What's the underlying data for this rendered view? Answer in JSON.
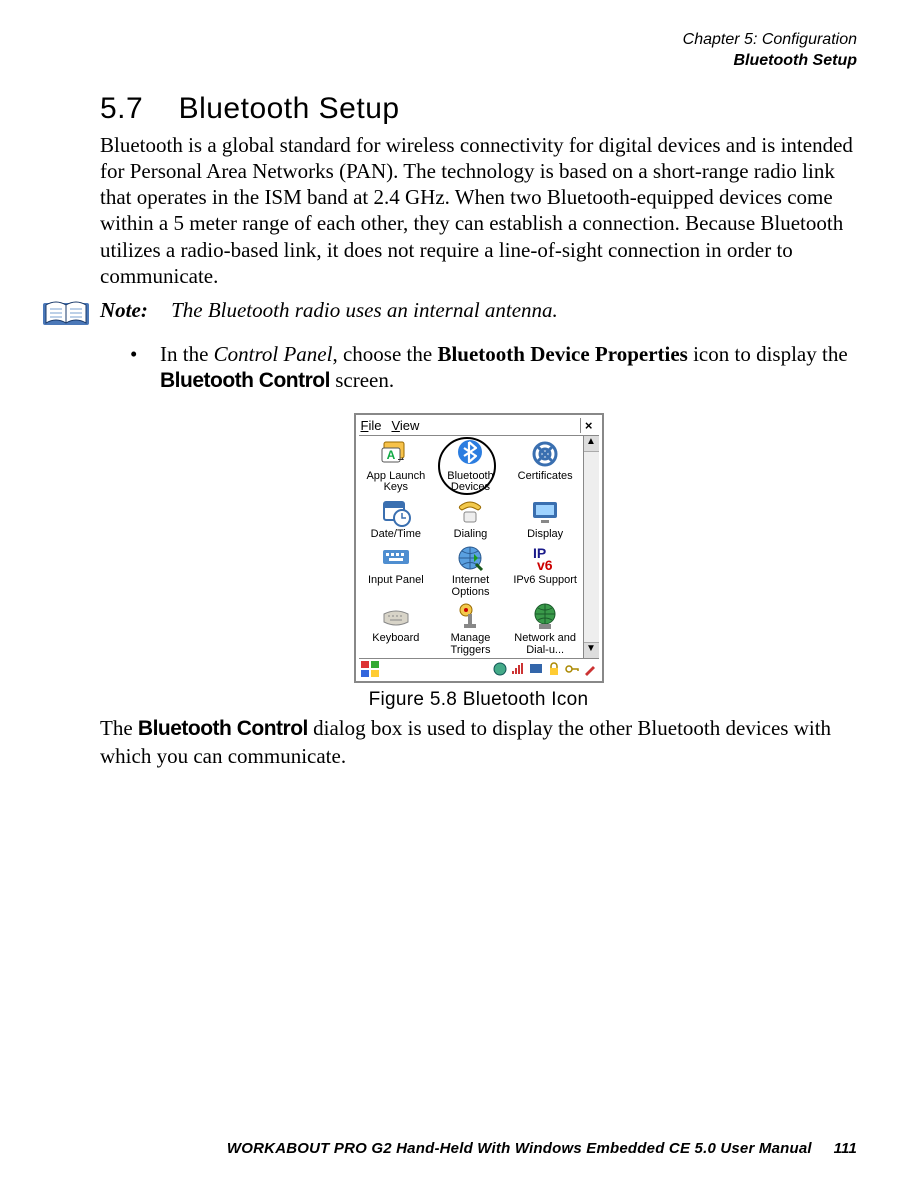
{
  "header": {
    "line1": "Chapter 5: Configuration",
    "line2": "Bluetooth Setup"
  },
  "section": {
    "number": "5.7",
    "title": "Bluetooth Setup"
  },
  "intro": "Bluetooth is a global standard for wireless connectivity for digital devices and is intended for Personal Area Networks (PAN). The technology is based on a short-range radio link that operates in the ISM band at 2.4 GHz. When two Bluetooth-equipped devices come within a 5 meter range of each other, they can establish a connection. Because Bluetooth utilizes a radio-based link, it does not require a line-of-sight connection in order to communicate.",
  "note": {
    "label": "Note:",
    "text": "The Bluetooth radio uses an internal antenna."
  },
  "bullet": {
    "pre": "In the ",
    "cp": "Control Panel",
    "mid1": ", choose the ",
    "bold": "Bluetooth Device Properties",
    "mid2": " icon to display the ",
    "sans": "Bluetooth Control",
    "end": " screen."
  },
  "panel": {
    "menu": {
      "file": "File",
      "view": "View",
      "close": "×"
    },
    "icons": [
      {
        "name": "app-launch-keys-icon",
        "label": "App Launch Keys"
      },
      {
        "name": "bluetooth-devices-icon",
        "label": "Bluetooth Devices"
      },
      {
        "name": "certificates-icon",
        "label": "Certificates"
      },
      {
        "name": "date-time-icon",
        "label": "Date/Time"
      },
      {
        "name": "dialing-icon",
        "label": "Dialing"
      },
      {
        "name": "display-icon",
        "label": "Display"
      },
      {
        "name": "input-panel-icon",
        "label": "Input Panel"
      },
      {
        "name": "internet-options-icon",
        "label": "Internet Options"
      },
      {
        "name": "ipv6-support-icon",
        "label": "IPv6 Support"
      },
      {
        "name": "keyboard-icon",
        "label": "Keyboard"
      },
      {
        "name": "manage-triggers-icon",
        "label": "Manage Triggers"
      },
      {
        "name": "network-dialup-icon",
        "label": "Network and Dial-u..."
      }
    ]
  },
  "figure_caption": "Figure 5.8 Bluetooth Icon",
  "after": {
    "pre": "The ",
    "sans": "Bluetooth Control",
    "rest": " dialog box is used to display the other Bluetooth devices with which you can communicate."
  },
  "footer": {
    "text": "WORKABOUT PRO G2 Hand-Held With Windows Embedded CE 5.0 User Manual",
    "page": "111"
  }
}
